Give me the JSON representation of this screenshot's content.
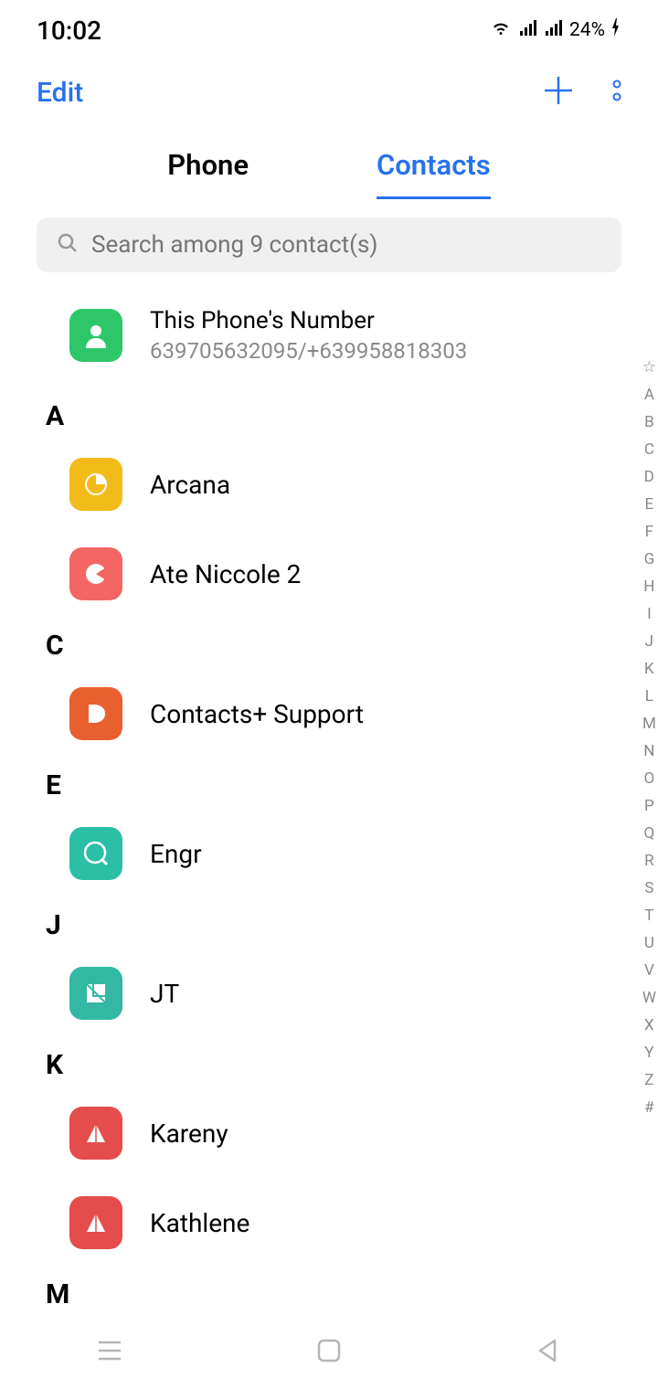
{
  "status": {
    "time": "10:02",
    "battery": "24%"
  },
  "header": {
    "edit": "Edit"
  },
  "tabs": {
    "phone": "Phone",
    "contacts": "Contacts"
  },
  "search": {
    "placeholder": "Search among 9 contact(s)"
  },
  "my": {
    "title": "This Phone's Number",
    "number": "639705632095/+639958818303"
  },
  "sections": {
    "A": "A",
    "C": "C",
    "E": "E",
    "J": "J",
    "K": "K",
    "M": "M"
  },
  "contacts": {
    "arcana": "Arcana",
    "ate": "Ate Niccole 2",
    "support": "Contacts+ Support",
    "engr": "Engr",
    "jt": "JT",
    "kareny": "Kareny",
    "kathlene": "Kathlene"
  },
  "index": [
    "A",
    "B",
    "C",
    "D",
    "E",
    "F",
    "G",
    "H",
    "I",
    "J",
    "K",
    "L",
    "M",
    "N",
    "O",
    "P",
    "Q",
    "R",
    "S",
    "T",
    "U",
    "V",
    "W",
    "X",
    "Y",
    "Z",
    "#"
  ]
}
